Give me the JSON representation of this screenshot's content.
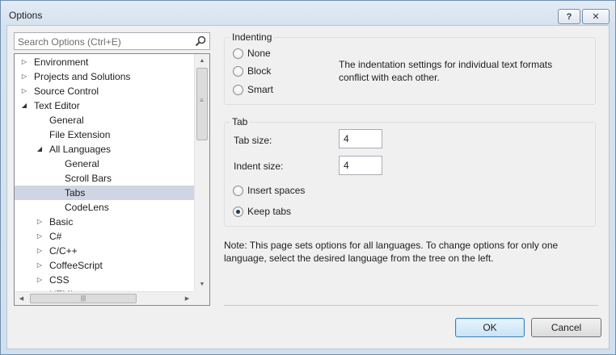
{
  "window": {
    "title": "Options",
    "help_label": "?",
    "close_label": "✕"
  },
  "search": {
    "placeholder": "Search Options (Ctrl+E)"
  },
  "tree": {
    "items": [
      {
        "label": "Environment",
        "level": 0,
        "arrow": "collapsed"
      },
      {
        "label": "Projects and Solutions",
        "level": 0,
        "arrow": "collapsed"
      },
      {
        "label": "Source Control",
        "level": 0,
        "arrow": "collapsed"
      },
      {
        "label": "Text Editor",
        "level": 0,
        "arrow": "expanded"
      },
      {
        "label": "General",
        "level": 1,
        "arrow": "none"
      },
      {
        "label": "File Extension",
        "level": 1,
        "arrow": "none"
      },
      {
        "label": "All Languages",
        "level": 1,
        "arrow": "expanded"
      },
      {
        "label": "General",
        "level": 2,
        "arrow": "none"
      },
      {
        "label": "Scroll Bars",
        "level": 2,
        "arrow": "none"
      },
      {
        "label": "Tabs",
        "level": 2,
        "arrow": "none",
        "selected": true
      },
      {
        "label": "CodeLens",
        "level": 2,
        "arrow": "none"
      },
      {
        "label": "Basic",
        "level": 1,
        "arrow": "collapsed"
      },
      {
        "label": "C#",
        "level": 1,
        "arrow": "collapsed"
      },
      {
        "label": "C/C++",
        "level": 1,
        "arrow": "collapsed"
      },
      {
        "label": "CoffeeScript",
        "level": 1,
        "arrow": "collapsed"
      },
      {
        "label": "CSS",
        "level": 1,
        "arrow": "collapsed"
      },
      {
        "label": "HTML",
        "level": 1,
        "arrow": "collapsed"
      }
    ]
  },
  "indenting": {
    "title": "Indenting",
    "options": [
      {
        "label": "None",
        "checked": false
      },
      {
        "label": "Block",
        "checked": false
      },
      {
        "label": "Smart",
        "checked": false
      }
    ],
    "message": "The indentation settings for individual text formats conflict with each other."
  },
  "tab": {
    "title": "Tab",
    "tab_size_label": "Tab size:",
    "tab_size_value": "4",
    "indent_size_label": "Indent size:",
    "indent_size_value": "4",
    "insert_spaces_label": "Insert spaces",
    "insert_spaces_checked": false,
    "keep_tabs_label": "Keep tabs",
    "keep_tabs_checked": true
  },
  "note": "Note: This page sets options for all languages. To change options for only one language, select the desired language from the tree on the left.",
  "buttons": {
    "ok": "OK",
    "cancel": "Cancel"
  },
  "scrollbar_glyphs": {
    "up": "▲",
    "down": "▼",
    "left": "◀",
    "right": "▶",
    "grip": "|||"
  }
}
